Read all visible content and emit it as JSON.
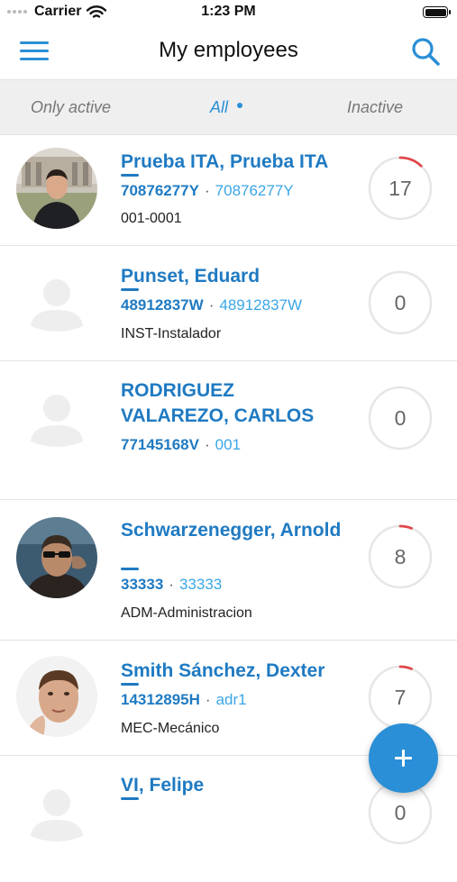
{
  "status_bar": {
    "carrier": "Carrier",
    "time": "1:23 PM"
  },
  "header": {
    "title": "My employees",
    "menu_icon": "hamburger-menu-icon",
    "search_icon": "search-icon"
  },
  "filters": {
    "tabs": [
      {
        "label": "Only active",
        "selected": false
      },
      {
        "label": "All",
        "selected": true
      },
      {
        "label": "Inactive",
        "selected": false
      }
    ]
  },
  "employees": [
    {
      "name": "Prueba ITA, Prueba ITA",
      "id": "70876277Y",
      "code": "70876277Y",
      "role": "001-0001",
      "count": "17",
      "progress": 0.12,
      "avatar": "photo"
    },
    {
      "name": "Punset, Eduard",
      "id": "48912837W",
      "code": "48912837W",
      "role": "INST-Instalador",
      "count": "0",
      "progress": 0,
      "avatar": "placeholder"
    },
    {
      "name": "RODRIGUEZ VALAREZO, CARLOS",
      "id": "77145168V",
      "code": "001",
      "role": "",
      "count": "0",
      "progress": 0,
      "avatar": "placeholder"
    },
    {
      "name": "Schwarzenegger, Arnold",
      "id": "33333",
      "code": "33333",
      "role": "ADM-Administracion",
      "count": "8",
      "progress": 0.06,
      "avatar": "photo"
    },
    {
      "name": "Smith Sánchez, Dexter",
      "id": "14312895H",
      "code": "adr1",
      "role": "MEC-Mecánico",
      "count": "7",
      "progress": 0.06,
      "avatar": "photo"
    },
    {
      "name": "VI, Felipe",
      "id": "",
      "code": "",
      "role": "",
      "count": "0",
      "progress": 0,
      "avatar": "placeholder"
    }
  ],
  "fab": {
    "icon": "plus-icon"
  },
  "colors": {
    "accent": "#2a8fd6",
    "name_blue": "#1f7ac2",
    "progress_red": "#e0474c"
  }
}
